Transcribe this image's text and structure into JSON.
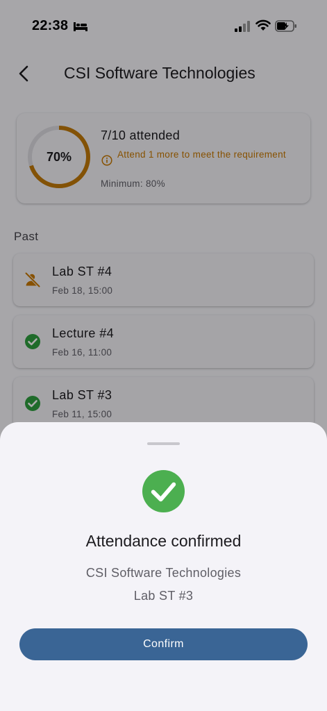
{
  "status_bar": {
    "time": "22:38",
    "icons": [
      "bed-icon",
      "signal-icon",
      "wifi-icon",
      "battery-charging-icon"
    ]
  },
  "header": {
    "title": "CSI Software Technologies",
    "back_icon": "chevron-left-icon"
  },
  "summary": {
    "percent_label": "70%",
    "percent_value": 70,
    "attended": "7/10 attended",
    "warning": "Attend 1 more to meet the requirement",
    "minimum": "Minimum: 80%",
    "ring_color": "#c27a0a",
    "warning_color": "#c77800"
  },
  "past": {
    "label": "Past",
    "sessions": [
      {
        "name": "Lab ST #4",
        "date": "Feb 18, 15:00",
        "status": "absent",
        "icon": "person-off-icon"
      },
      {
        "name": "Lecture #4",
        "date": "Feb 16, 11:00",
        "status": "attended",
        "icon": "check-circle-icon"
      },
      {
        "name": "Lab ST #3",
        "date": "Feb 11, 15:00",
        "status": "attended",
        "icon": "check-circle-icon"
      }
    ]
  },
  "sheet": {
    "title": "Attendance confirmed",
    "course": "CSI Software Technologies",
    "session": "Lab ST #3",
    "confirm_label": "Confirm",
    "success_color": "#4caf50",
    "button_color": "#3a6595"
  }
}
